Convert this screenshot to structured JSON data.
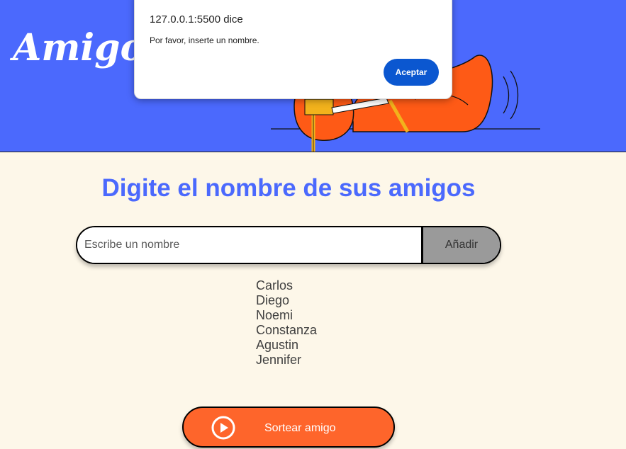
{
  "header": {
    "title": "Amigo S"
  },
  "dialog": {
    "origin": "127.0.0.1:5500 dice",
    "message": "Por favor, inserte un nombre.",
    "ok_label": "Aceptar"
  },
  "main": {
    "heading": "Digite el nombre de sus amigos",
    "input_placeholder": "Escribe un nombre",
    "input_value": "",
    "add_label": "Añadir",
    "friends": [
      "Carlos",
      "Diego",
      "Noemi",
      "Constanza",
      "Agustin",
      "Jennifer"
    ],
    "draw_label": "Sortear amigo"
  },
  "icons": {
    "draw_icon": "play-circle-icon"
  },
  "colors": {
    "primary_blue": "#4b69fd",
    "accent_orange": "#fe652b",
    "background": "#fdf7e9",
    "dialog_button": "#0b57d0"
  }
}
